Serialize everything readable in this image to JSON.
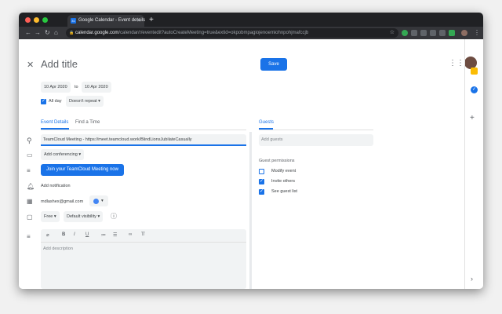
{
  "browser": {
    "tab_title": "Google Calendar - Event details",
    "favicon_text": "31",
    "url_host": "calendar.google.com",
    "url_path": "/calendar/r/eventedit?autoCreateMeeting=true&extid=okpobmpagiojenoemiohnpohjmafccjb"
  },
  "event": {
    "title_placeholder": "Add title",
    "save_label": "Save",
    "start_date": "10 Apr 2020",
    "to_label": "to",
    "end_date": "10 Apr 2020",
    "all_day_label": "All day",
    "all_day_checked": true,
    "repeat_value": "Doesn't repeat"
  },
  "tabs": {
    "event_details": "Event Details",
    "find_a_time": "Find a Time",
    "guests": "Guests"
  },
  "details": {
    "location_value": "TeamCloud Meeting - https://meet.teamcloud.work/BlindLionsJubilateCasually",
    "conferencing_label": "Add conferencing",
    "join_button": "Join your TeamCloud Meeting now",
    "notification_label": "Add notification",
    "calendar_owner": "mdlashex@gmail.com",
    "calendar_color": "#4285f4",
    "availability": "Free",
    "visibility": "Default visibility",
    "description_placeholder": "Add description"
  },
  "guests": {
    "input_placeholder": "Add guests",
    "permissions_heading": "Guest permissions",
    "permissions": [
      {
        "label": "Modify event",
        "checked": false
      },
      {
        "label": "Invite others",
        "checked": true
      },
      {
        "label": "See guest list",
        "checked": true
      }
    ]
  },
  "colors": {
    "accent": "#1a73e8",
    "keep_yellow": "#fbbc04",
    "tasks_blue": "#1a73e8"
  }
}
